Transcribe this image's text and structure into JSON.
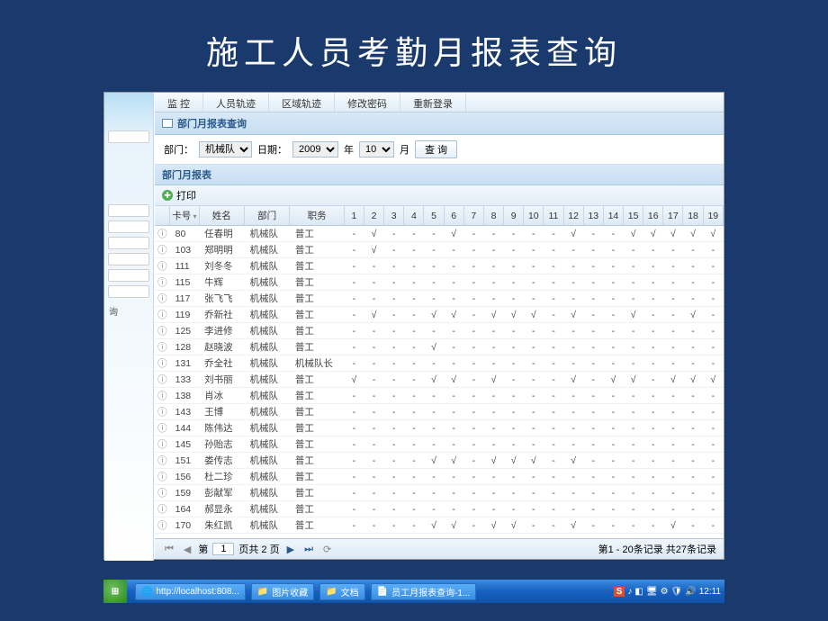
{
  "slide_title": "施工人员考勤月报表查询",
  "sidebar": {
    "query_text": "询"
  },
  "top_tabs": [
    "监 控",
    "人员轨迹",
    "区域轨迹",
    "修改密码",
    "重新登录"
  ],
  "panel": {
    "title": "部门月报表查询",
    "dept_label": "部门：",
    "dept_value": "机械队",
    "date_label": "日期：",
    "year_value": "2009",
    "year_suffix": "年",
    "month_value": "10",
    "month_suffix": "月",
    "query_btn": "查 询",
    "sub_title": "部门月报表",
    "print_label": "打印"
  },
  "columns": {
    "card": "卡号",
    "name": "姓名",
    "dept": "部门",
    "job": "职务"
  },
  "day_cols": [
    "1",
    "2",
    "3",
    "4",
    "5",
    "6",
    "7",
    "8",
    "9",
    "10",
    "11",
    "12",
    "13",
    "14",
    "15",
    "16",
    "17",
    "18",
    "19"
  ],
  "rows": [
    {
      "card": "80",
      "name": "任春明",
      "dept": "机械队",
      "job": "普工",
      "d": [
        "-",
        "√",
        "-",
        "-",
        "-",
        "√",
        "-",
        "-",
        "-",
        "-",
        "-",
        "√",
        "-",
        "-",
        "√",
        "√",
        "√",
        "√",
        "√"
      ]
    },
    {
      "card": "103",
      "name": "郑明明",
      "dept": "机械队",
      "job": "普工",
      "d": [
        "-",
        "√",
        "-",
        "-",
        "-",
        "-",
        "-",
        "-",
        "-",
        "-",
        "-",
        "-",
        "-",
        "-",
        "-",
        "-",
        "-",
        "-",
        "-"
      ]
    },
    {
      "card": "111",
      "name": "刘冬冬",
      "dept": "机械队",
      "job": "普工",
      "d": [
        "-",
        "-",
        "-",
        "-",
        "-",
        "-",
        "-",
        "-",
        "-",
        "-",
        "-",
        "-",
        "-",
        "-",
        "-",
        "-",
        "-",
        "-",
        "-"
      ]
    },
    {
      "card": "115",
      "name": "牛辉",
      "dept": "机械队",
      "job": "普工",
      "d": [
        "-",
        "-",
        "-",
        "-",
        "-",
        "-",
        "-",
        "-",
        "-",
        "-",
        "-",
        "-",
        "-",
        "-",
        "-",
        "-",
        "-",
        "-",
        "-"
      ]
    },
    {
      "card": "117",
      "name": "张飞飞",
      "dept": "机械队",
      "job": "普工",
      "d": [
        "-",
        "-",
        "-",
        "-",
        "-",
        "-",
        "-",
        "-",
        "-",
        "-",
        "-",
        "-",
        "-",
        "-",
        "-",
        "-",
        "-",
        "-",
        "-"
      ]
    },
    {
      "card": "119",
      "name": "乔新社",
      "dept": "机械队",
      "job": "普工",
      "d": [
        "-",
        "√",
        "-",
        "-",
        "√",
        "√",
        "-",
        "√",
        "√",
        "√",
        "-",
        "√",
        "-",
        "-",
        "√",
        "-",
        "-",
        "√",
        "-"
      ]
    },
    {
      "card": "125",
      "name": "李进修",
      "dept": "机械队",
      "job": "普工",
      "d": [
        "-",
        "-",
        "-",
        "-",
        "-",
        "-",
        "-",
        "-",
        "-",
        "-",
        "-",
        "-",
        "-",
        "-",
        "-",
        "-",
        "-",
        "-",
        "-"
      ]
    },
    {
      "card": "128",
      "name": "赵晓波",
      "dept": "机械队",
      "job": "普工",
      "d": [
        "-",
        "-",
        "-",
        "-",
        "√",
        "-",
        "-",
        "-",
        "-",
        "-",
        "-",
        "-",
        "-",
        "-",
        "-",
        "-",
        "-",
        "-",
        "-"
      ]
    },
    {
      "card": "131",
      "name": "乔全社",
      "dept": "机械队",
      "job": "机械队长",
      "d": [
        "-",
        "-",
        "-",
        "-",
        "-",
        "-",
        "-",
        "-",
        "-",
        "-",
        "-",
        "-",
        "-",
        "-",
        "-",
        "-",
        "-",
        "-",
        "-"
      ]
    },
    {
      "card": "133",
      "name": "刘书丽",
      "dept": "机械队",
      "job": "普工",
      "d": [
        "√",
        "-",
        "-",
        "-",
        "√",
        "√",
        "-",
        "√",
        "-",
        "-",
        "-",
        "√",
        "-",
        "√",
        "√",
        "-",
        "√",
        "√",
        "√"
      ]
    },
    {
      "card": "138",
      "name": "肖冰",
      "dept": "机械队",
      "job": "普工",
      "d": [
        "-",
        "-",
        "-",
        "-",
        "-",
        "-",
        "-",
        "-",
        "-",
        "-",
        "-",
        "-",
        "-",
        "-",
        "-",
        "-",
        "-",
        "-",
        "-"
      ]
    },
    {
      "card": "143",
      "name": "王博",
      "dept": "机械队",
      "job": "普工",
      "d": [
        "-",
        "-",
        "-",
        "-",
        "-",
        "-",
        "-",
        "-",
        "-",
        "-",
        "-",
        "-",
        "-",
        "-",
        "-",
        "-",
        "-",
        "-",
        "-"
      ]
    },
    {
      "card": "144",
      "name": "陈伟达",
      "dept": "机械队",
      "job": "普工",
      "d": [
        "-",
        "-",
        "-",
        "-",
        "-",
        "-",
        "-",
        "-",
        "-",
        "-",
        "-",
        "-",
        "-",
        "-",
        "-",
        "-",
        "-",
        "-",
        "-"
      ]
    },
    {
      "card": "145",
      "name": "孙贻志",
      "dept": "机械队",
      "job": "普工",
      "d": [
        "-",
        "-",
        "-",
        "-",
        "-",
        "-",
        "-",
        "-",
        "-",
        "-",
        "-",
        "-",
        "-",
        "-",
        "-",
        "-",
        "-",
        "-",
        "-"
      ]
    },
    {
      "card": "151",
      "name": "娄传志",
      "dept": "机械队",
      "job": "普工",
      "d": [
        "-",
        "-",
        "-",
        "-",
        "√",
        "√",
        "-",
        "√",
        "√",
        "√",
        "-",
        "√",
        "-",
        "-",
        "-",
        "-",
        "-",
        "-",
        "-"
      ]
    },
    {
      "card": "156",
      "name": "杜二珍",
      "dept": "机械队",
      "job": "普工",
      "d": [
        "-",
        "-",
        "-",
        "-",
        "-",
        "-",
        "-",
        "-",
        "-",
        "-",
        "-",
        "-",
        "-",
        "-",
        "-",
        "-",
        "-",
        "-",
        "-"
      ]
    },
    {
      "card": "159",
      "name": "彭献军",
      "dept": "机械队",
      "job": "普工",
      "d": [
        "-",
        "-",
        "-",
        "-",
        "-",
        "-",
        "-",
        "-",
        "-",
        "-",
        "-",
        "-",
        "-",
        "-",
        "-",
        "-",
        "-",
        "-",
        "-"
      ]
    },
    {
      "card": "164",
      "name": "郝显永",
      "dept": "机械队",
      "job": "普工",
      "d": [
        "-",
        "-",
        "-",
        "-",
        "-",
        "-",
        "-",
        "-",
        "-",
        "-",
        "-",
        "-",
        "-",
        "-",
        "-",
        "-",
        "-",
        "-",
        "-"
      ]
    },
    {
      "card": "170",
      "name": "朱红凯",
      "dept": "机械队",
      "job": "普工",
      "d": [
        "-",
        "-",
        "-",
        "-",
        "√",
        "√",
        "-",
        "√",
        "√",
        "-",
        "-",
        "√",
        "-",
        "-",
        "-",
        "-",
        "√",
        "-",
        "-"
      ]
    }
  ],
  "pager": {
    "page_label_prefix": "第",
    "page_value": "1",
    "page_label_mid": "页共 2 页",
    "summary": "第1 - 20条记录 共27条记录"
  },
  "taskbar": {
    "items": [
      "http://localhost:808...",
      "图片收藏",
      "文档",
      "员工月报表查询-1..."
    ],
    "clock": "12:11"
  }
}
